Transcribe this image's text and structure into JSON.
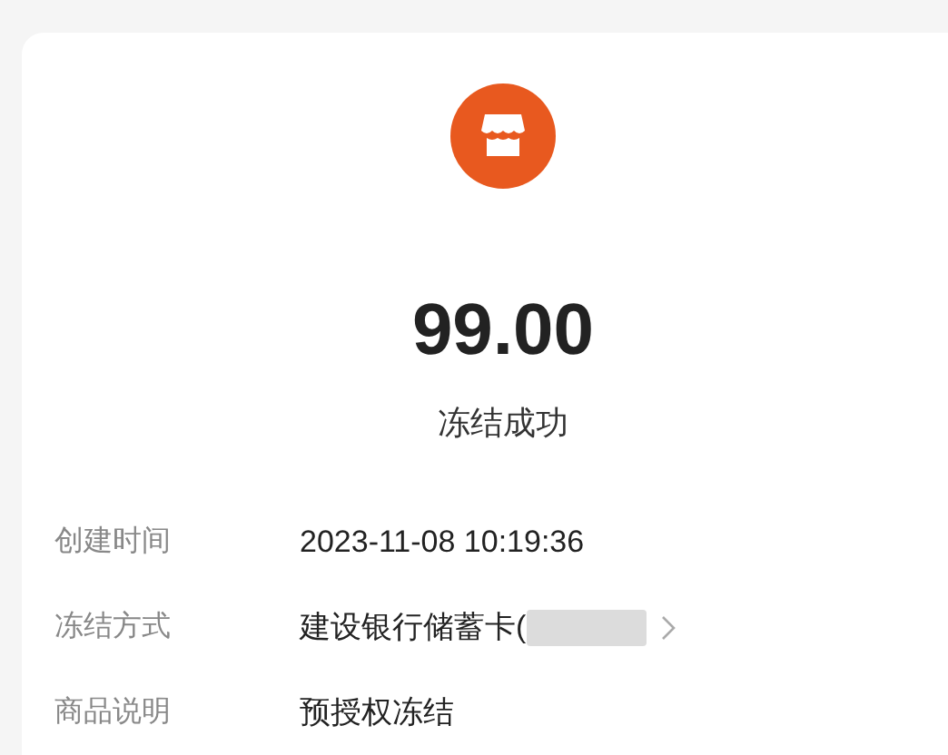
{
  "amount": "99.00",
  "status": "冻结成功",
  "details": [
    {
      "label": "创建时间",
      "value": "2023-11-08 10:19:36",
      "masked": false,
      "link": false
    },
    {
      "label": "冻结方式",
      "value": "建设银行储蓄卡(",
      "masked": true,
      "link": true
    },
    {
      "label": "商品说明",
      "value": "预授权冻结",
      "masked": false,
      "link": false
    }
  ]
}
